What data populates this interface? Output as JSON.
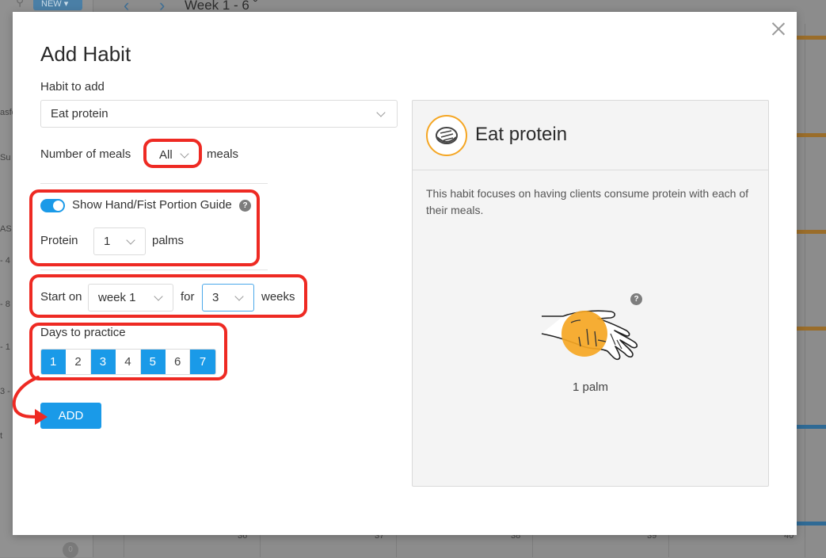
{
  "background": {
    "new_button": "NEW",
    "week_range": "Week 1 - 6",
    "side_texts": [
      "asfo",
      "Su",
      "AS",
      "- 4",
      "- 8",
      "- 1",
      "3 -",
      "t"
    ],
    "week_numbers": [
      "36",
      "37",
      "38",
      "39",
      "40"
    ]
  },
  "modal": {
    "title": "Add Habit",
    "habit_label": "Habit to add",
    "habit_value": "Eat protein",
    "meals_label": "Number of meals",
    "meals_value": "All",
    "meals_suffix": "meals",
    "guide_toggle_label": "Show Hand/Fist Portion Guide",
    "guide_toggle_on": true,
    "help_symbol": "?",
    "protein_label": "Protein",
    "protein_value": "1",
    "protein_unit": "palms",
    "start_label": "Start on",
    "start_value": "week 1",
    "for_label": "for",
    "duration_value": "3",
    "duration_unit": "weeks",
    "days_label": "Days to practice",
    "days": [
      {
        "label": "1",
        "selected": true
      },
      {
        "label": "2",
        "selected": false
      },
      {
        "label": "3",
        "selected": true
      },
      {
        "label": "4",
        "selected": false
      },
      {
        "label": "5",
        "selected": true
      },
      {
        "label": "6",
        "selected": false
      },
      {
        "label": "7",
        "selected": true
      }
    ],
    "add_button": "ADD"
  },
  "preview": {
    "title": "Eat protein",
    "icon": "meat-steak-icon",
    "description": "This habit focuses on having clients consume protein with each of their meals.",
    "portion_text": "1 palm",
    "portion_icon": "palm-hand-icon"
  },
  "colors": {
    "accent": "#1a9ae8",
    "annotation": "#ee2a23",
    "icon_orange": "#f5a623"
  }
}
